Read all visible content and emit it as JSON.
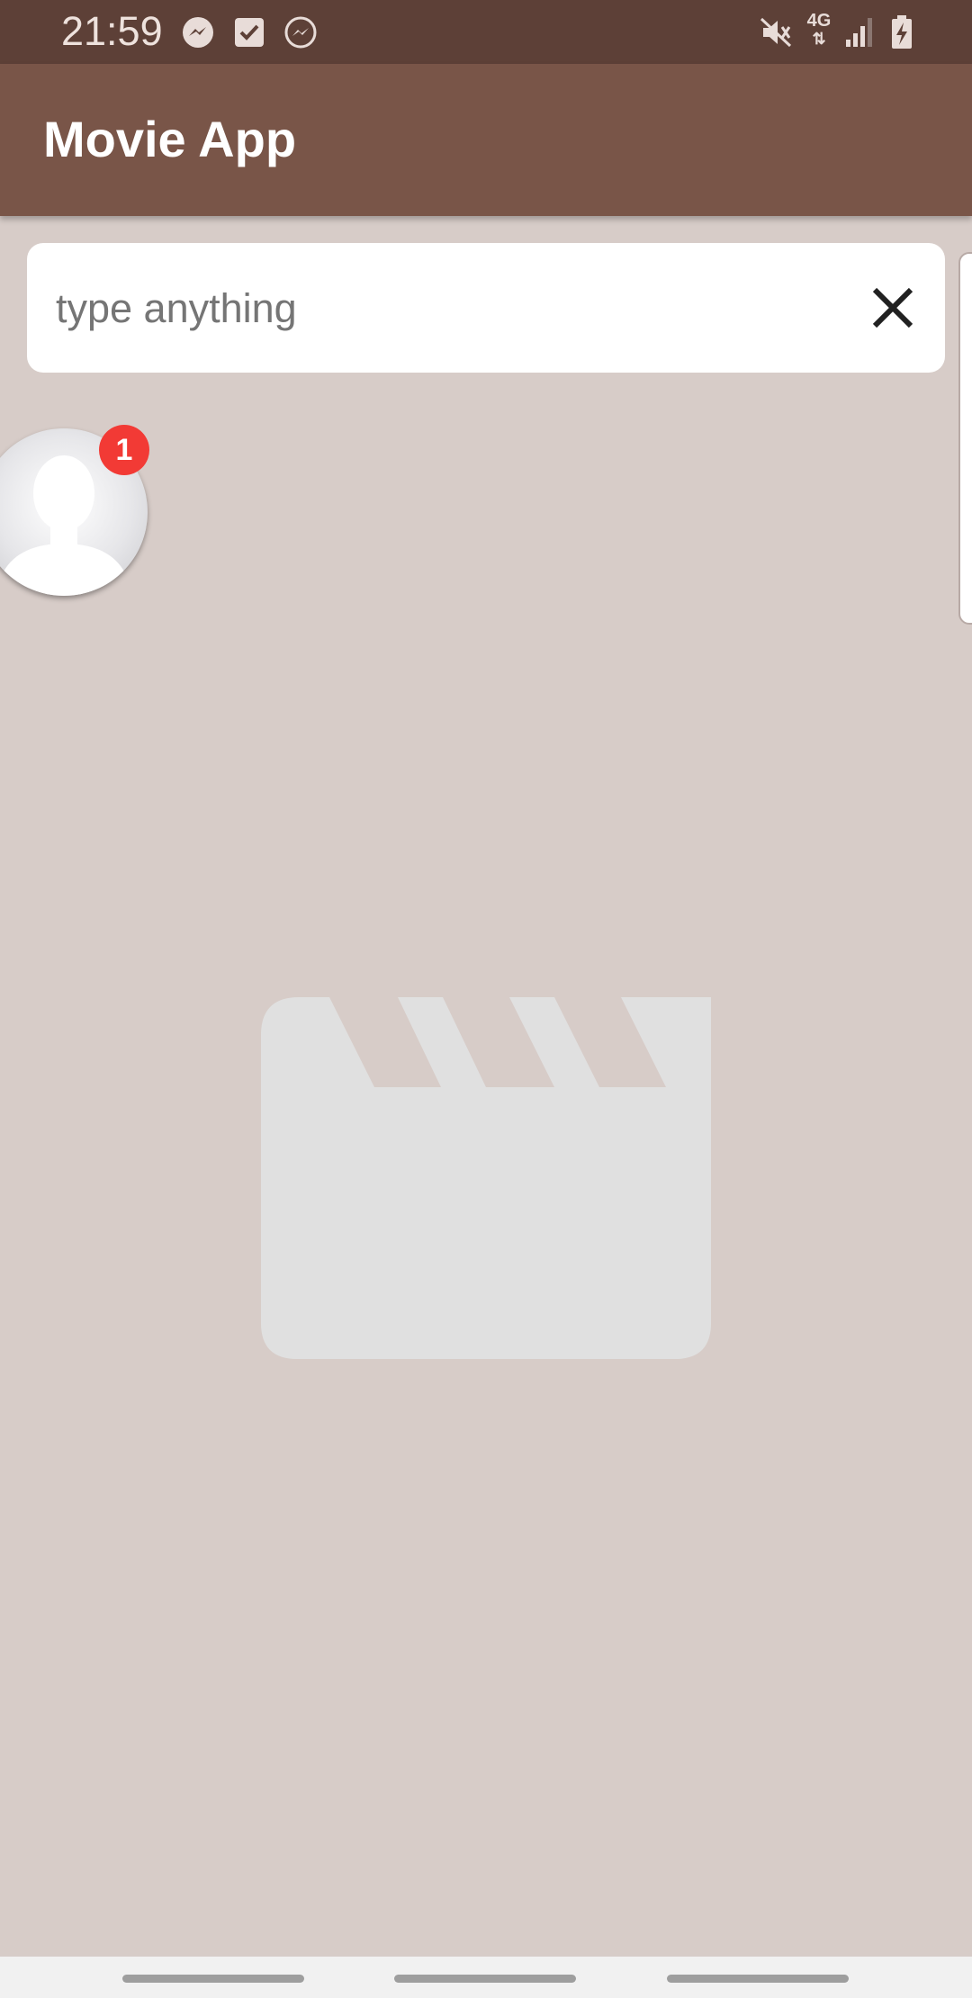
{
  "status_bar": {
    "time": "21:59",
    "left_icons": [
      "messenger-icon",
      "checkbox-icon",
      "messenger-outline-icon"
    ],
    "right_icons": [
      "mute-icon",
      "4g-icon",
      "signal-icon",
      "battery-charging-icon"
    ],
    "network_label": "4G"
  },
  "app_bar": {
    "title": "Movie App",
    "background": "#795548"
  },
  "search": {
    "placeholder": "type anything",
    "value": "",
    "clear_icon": "close-icon"
  },
  "avatar": {
    "badge_count": "1",
    "badge_color": "#f23a35"
  },
  "empty_state": {
    "icon": "movie-clapperboard-icon"
  },
  "colors": {
    "status_bar": "#5d4037",
    "background": "#d7ccc8",
    "placeholder_icon": "#e0e0e0"
  }
}
